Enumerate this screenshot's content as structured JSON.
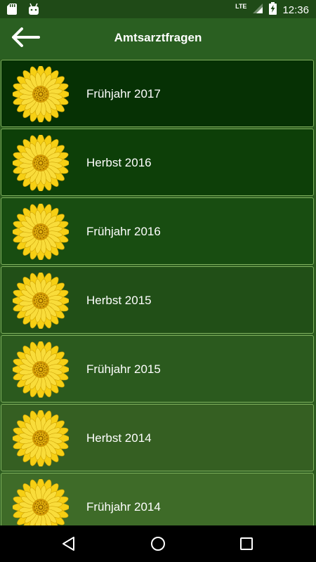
{
  "status_bar": {
    "time": "12:36",
    "network": "LTE",
    "left_icons": [
      "sd-card-icon",
      "android-icon"
    ],
    "right_icons": [
      "signal-icon",
      "battery-charging-icon"
    ]
  },
  "app_bar": {
    "title": "Amtsarztfragen",
    "back_icon": "arrow-left-icon"
  },
  "colors": {
    "status_bar": "#1f4a17",
    "app_bar": "#2a5f21",
    "item_border": "#7fb15e",
    "flower_petal": "#f6cf14",
    "item_gradient": [
      "#063104",
      "#0d3f08",
      "#184d11",
      "#214f17",
      "#2b5a1e",
      "#355f22",
      "#3e6b28"
    ]
  },
  "items": [
    {
      "label": "Frühjahr 2017",
      "icon": "sunflower-icon"
    },
    {
      "label": "Herbst 2016",
      "icon": "sunflower-icon"
    },
    {
      "label": "Frühjahr 2016",
      "icon": "sunflower-icon"
    },
    {
      "label": "Herbst 2015",
      "icon": "sunflower-icon"
    },
    {
      "label": "Frühjahr 2015",
      "icon": "sunflower-icon"
    },
    {
      "label": "Herbst 2014",
      "icon": "sunflower-icon"
    },
    {
      "label": "Frühjahr 2014",
      "icon": "sunflower-icon"
    }
  ],
  "nav_bar": {
    "icons": [
      "back-triangle-icon",
      "home-circle-icon",
      "recents-square-icon"
    ]
  }
}
